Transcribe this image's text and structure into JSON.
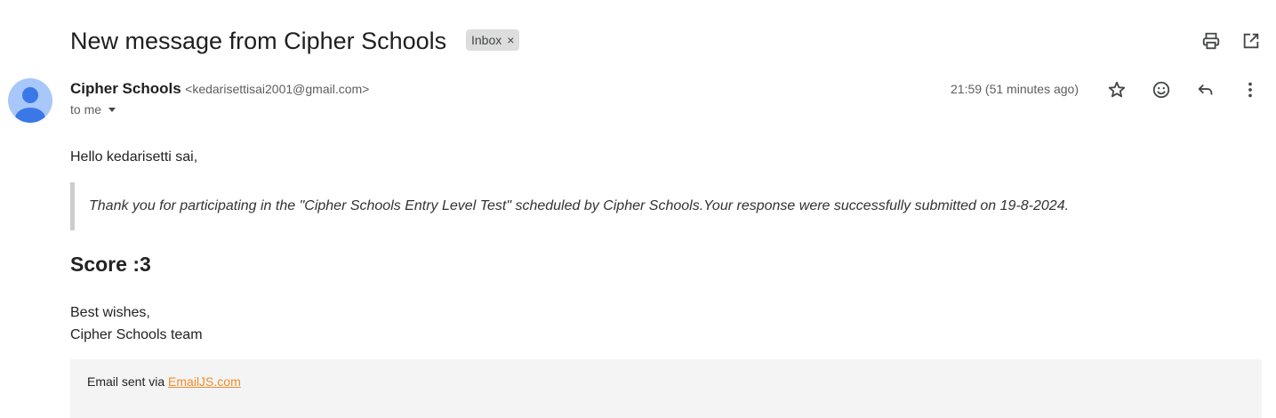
{
  "header": {
    "subject": "New message from Cipher Schools",
    "label": "Inbox",
    "label_remove": "×",
    "print_icon": "print-icon",
    "open_new_window_icon": "open-in-new-icon"
  },
  "sender": {
    "name": "Cipher Schools",
    "email": "<kedarisettisai2001@gmail.com>",
    "recipient_text": "to me",
    "timestamp": "21:59 (51 minutes ago)",
    "avatar_color": "#a8c7fa",
    "avatar_figure_color": "#3b78e7"
  },
  "actions": {
    "star_icon": "star-icon",
    "emoji_icon": "emoji-icon",
    "reply_icon": "reply-icon",
    "more_icon": "more-vert-icon"
  },
  "message": {
    "greeting": "Hello kedarisetti sai,",
    "quote": "Thank you for participating in the \"Cipher Schools Entry Level Test\" scheduled by Cipher Schools.Your response were successfully submitted on 19-8-2024.",
    "score": "Score :3",
    "signoff_line1": "Best wishes,",
    "signoff_line2": "Cipher Schools team"
  },
  "footer": {
    "prefix": "Email sent via ",
    "link_text": "EmailJS.com",
    "link_color": "#f28b2c"
  }
}
